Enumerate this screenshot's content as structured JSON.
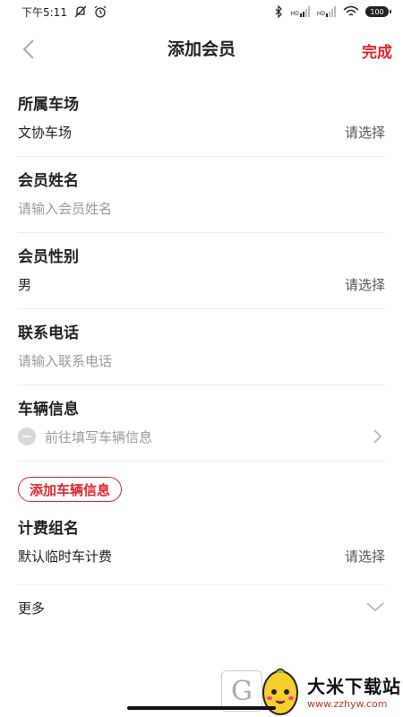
{
  "status_bar": {
    "time": "下午5:11",
    "battery": "100",
    "signal_hd_1": "HD",
    "signal_hd_2": "HD",
    "icons": [
      "mute-icon",
      "alarm-icon",
      "bluetooth-icon",
      "cell-signal-icon",
      "wifi-icon",
      "battery-icon"
    ]
  },
  "nav": {
    "back_icon": "chevron-left-icon",
    "title": "添加会员",
    "done_label": "完成"
  },
  "form": {
    "parking_lot": {
      "label": "所属车场",
      "value": "文协车场",
      "action": "请选择"
    },
    "member_name": {
      "label": "会员姓名",
      "placeholder": "请输入会员姓名"
    },
    "member_gender": {
      "label": "会员性别",
      "value": "男",
      "action": "请选择"
    },
    "phone": {
      "label": "联系电话",
      "placeholder": "请输入联系电话"
    },
    "vehicle": {
      "label": "车辆信息",
      "placeholder": "前往填写车辆信息"
    },
    "add_vehicle_label": "添加车辆信息",
    "fee_group": {
      "label": "计费组名",
      "value": "默认临时车计费",
      "action": "请选择"
    },
    "more_label": "更多"
  },
  "watermark": {
    "title": "大米下载站",
    "url": "www.zzhyw.com"
  },
  "colors": {
    "accent": "#e0262e",
    "text": "#222222",
    "placeholder": "#9a9a9a",
    "divider": "#eeeeee"
  }
}
